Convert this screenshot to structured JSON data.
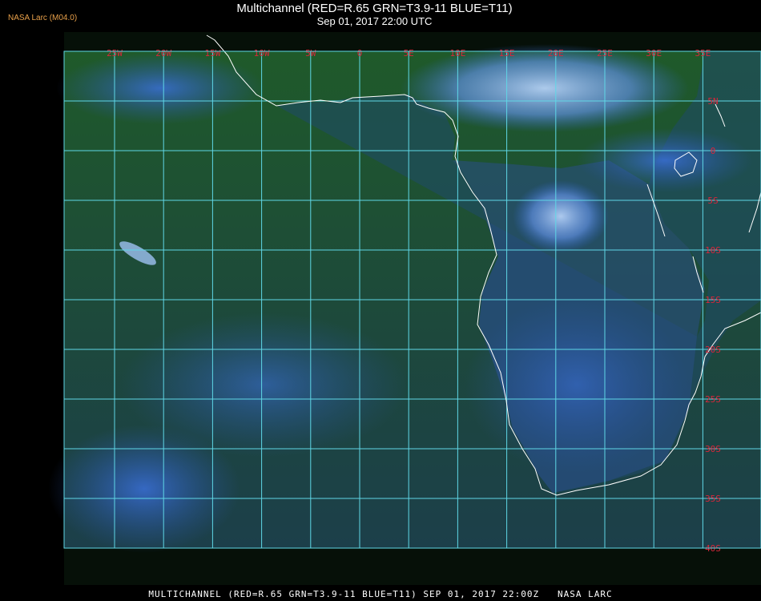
{
  "header": {
    "source_tag": "NASA Larc (M04.0)",
    "title": "Multichannel (RED=R.65 GRN=T3.9-11 BLUE=T11)",
    "timestamp": "Sep 01, 2017 22:00 UTC"
  },
  "map": {
    "longitude_labels": [
      "25W",
      "20W",
      "15W",
      "10W",
      "5W",
      "0",
      "5E",
      "10E",
      "15E",
      "20E",
      "25E",
      "30E",
      "35E"
    ],
    "latitude_labels": [
      "5N",
      "0",
      "5S",
      "10S",
      "15S",
      "20S",
      "25S",
      "30S",
      "35S",
      "40S"
    ],
    "colors": {
      "grid": "#5fd7e6",
      "label": "#d9263a",
      "coastline": "#ffffff",
      "ocean": "#1e4a20",
      "cloud": "#2f63c9",
      "bright_cloud": "#9fc2f2"
    }
  },
  "footer": {
    "caption": "MULTICHANNEL (RED=R.65 GRN=T3.9-11 BLUE=T11) SEP 01, 2017 22:00Z   NASA LARC"
  }
}
